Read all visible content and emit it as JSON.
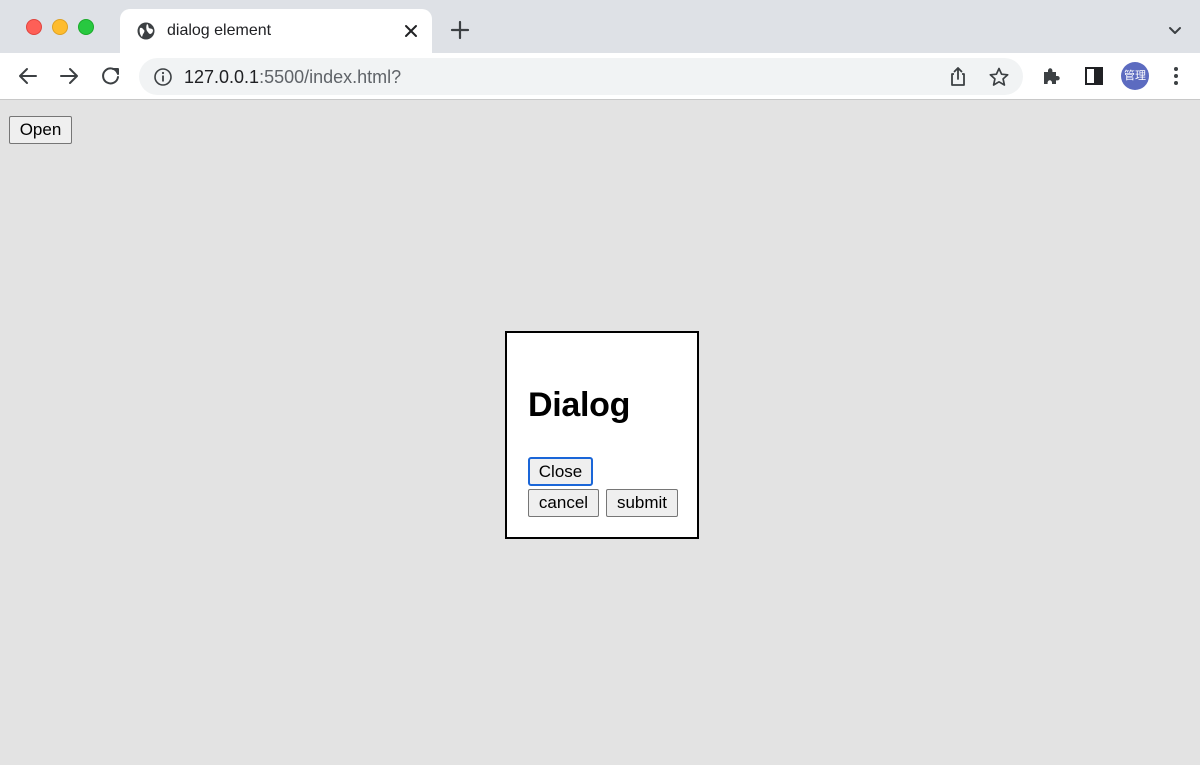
{
  "browser": {
    "tab": {
      "title": "dialog element"
    },
    "address": {
      "host": "127.0.0.1",
      "rest": ":5500/index.html?"
    },
    "profile": {
      "avatar_text": "管理"
    }
  },
  "page": {
    "open_button": "Open",
    "dialog": {
      "title": "Dialog",
      "close_button": "Close",
      "cancel_button": "cancel",
      "submit_button": "submit"
    }
  },
  "icons": {
    "tab": [
      "globe-icon",
      "close-icon",
      "plus-icon",
      "chevron-down-icon"
    ],
    "toolbar": [
      "arrow-left-icon",
      "arrow-right-icon",
      "reload-icon",
      "info-icon",
      "share-icon",
      "star-icon",
      "puzzle-icon",
      "side-panel-icon",
      "more-vert-icon"
    ]
  },
  "colors": {
    "page_bg": "#e3e3e3",
    "focus_ring": "#1a66d8",
    "avatar_bg": "#5c6bc0"
  }
}
